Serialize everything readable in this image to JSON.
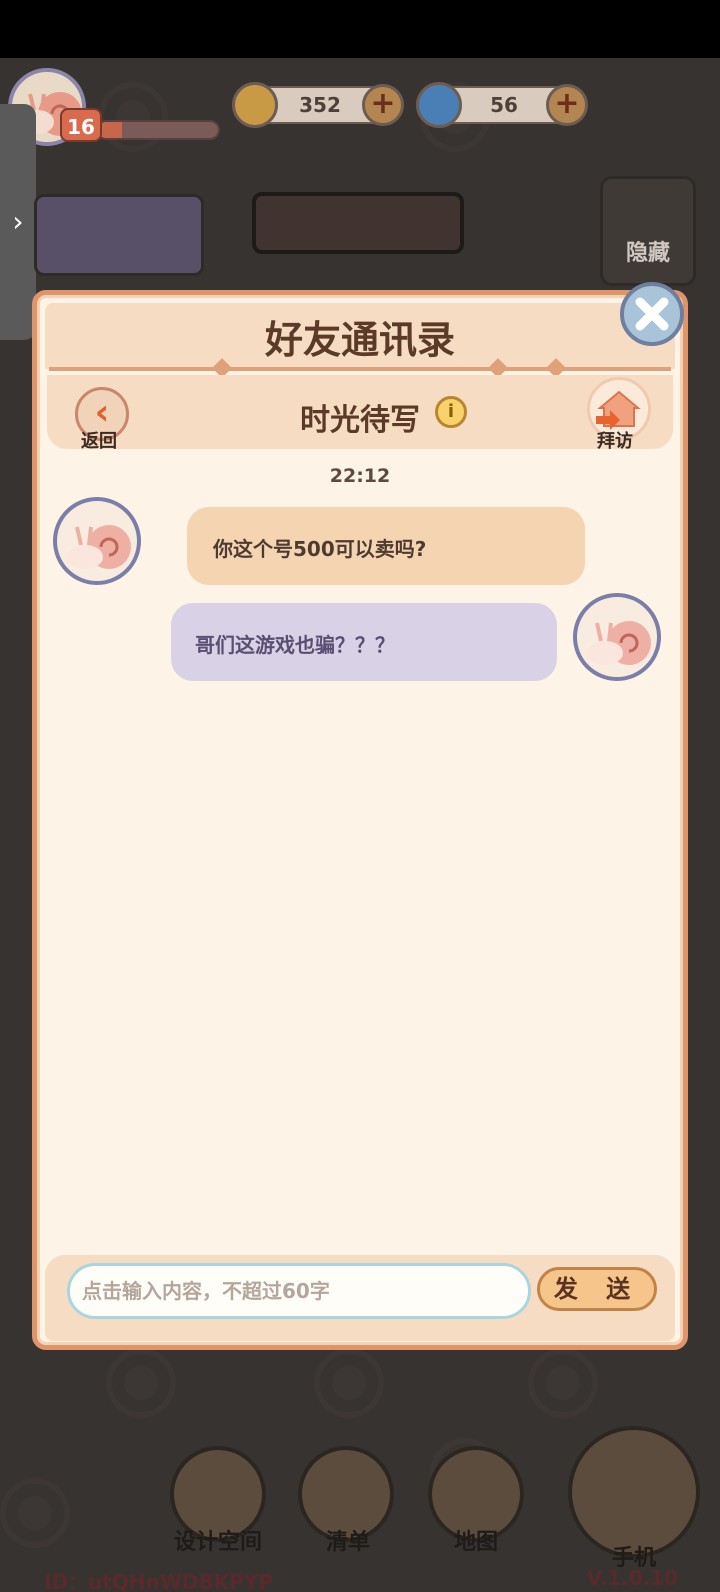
{
  "hud": {
    "level": "16",
    "xp_progress": 0.2,
    "coins": "352",
    "gems": "56",
    "hide_label": "隐藏"
  },
  "dialog": {
    "title": "好友通讯录",
    "back_label": "返回",
    "friend_name": "时光待写",
    "visit_label": "拜访",
    "timestamp": "22:12",
    "messages": [
      {
        "side": "left",
        "text": "你这个号500可以卖吗?"
      },
      {
        "side": "right",
        "text": "哥们这游戏也骗？？？"
      }
    ],
    "input_placeholder": "点击输入内容，不超过60字",
    "send_label": "发 送"
  },
  "bottom_nav": {
    "design_space": "设计空间",
    "list": "清单",
    "map": "地图",
    "phone": "手机"
  },
  "footer": {
    "id_text": "ID：utQHnWDBKPYP",
    "version": "V.1.0.10"
  },
  "colors": {
    "dialog_bg": "#fdf3e6",
    "dialog_border": "#e0946a",
    "left_bubble": "#f5d4b2",
    "right_bubble": "#d9d1e6"
  }
}
